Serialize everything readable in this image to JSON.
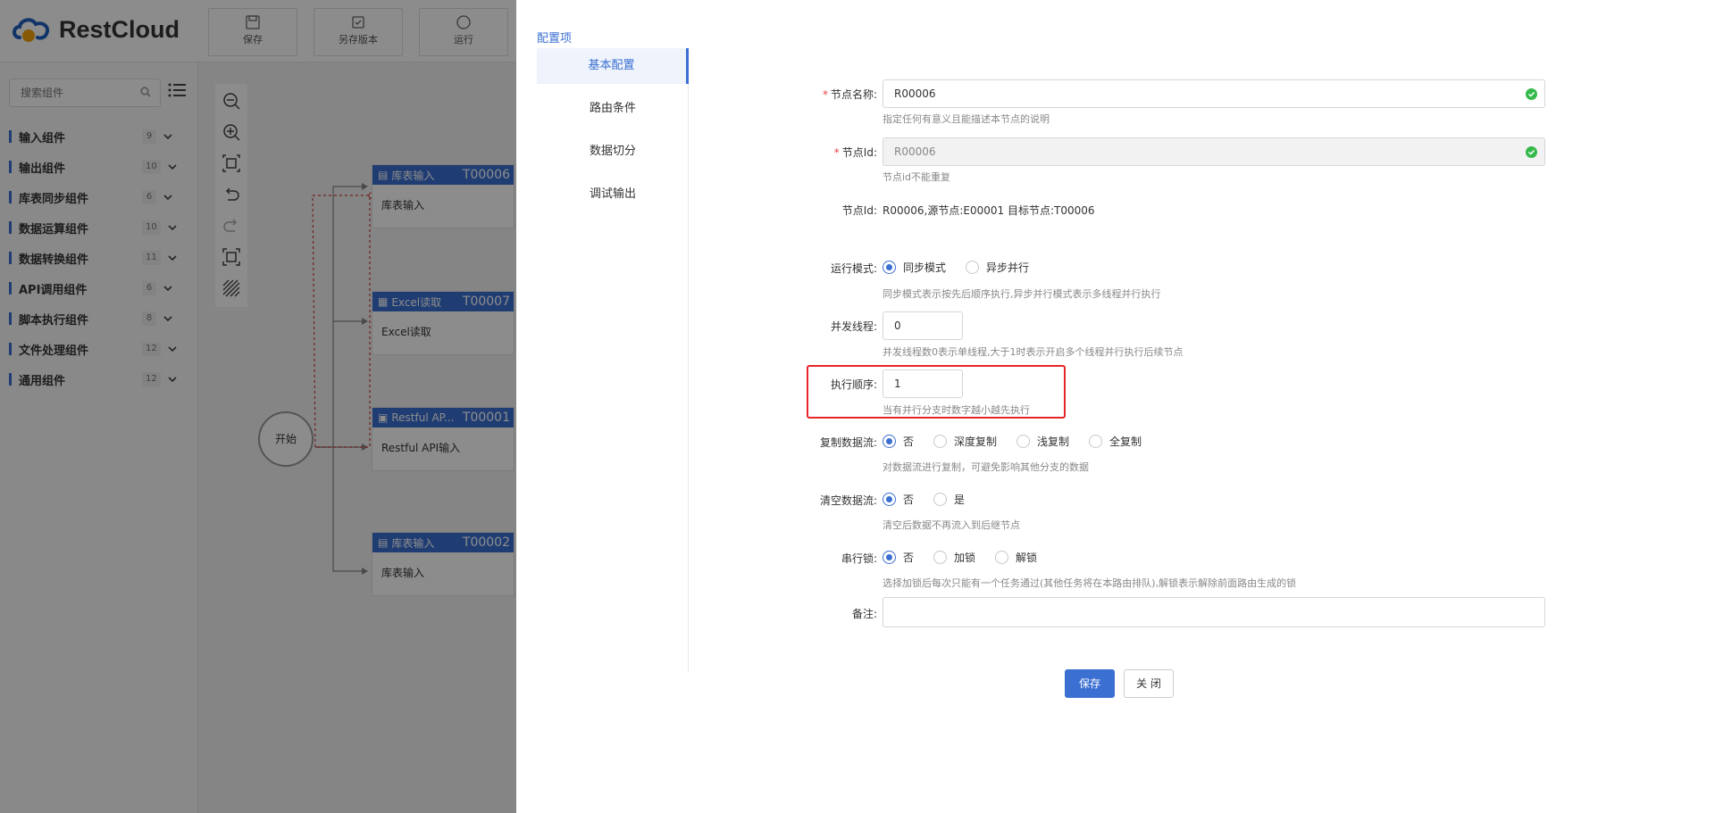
{
  "app": {
    "logo_text": "RestCloud",
    "toolbar": {
      "save_label": "保存",
      "save_as_label": "另存版本",
      "run_label": "运行"
    }
  },
  "sidebar": {
    "search_placeholder": "搜索组件",
    "categories": [
      {
        "label": "输入组件",
        "count": "9"
      },
      {
        "label": "输出组件",
        "count": "10"
      },
      {
        "label": "库表同步组件",
        "count": "6"
      },
      {
        "label": "数据运算组件",
        "count": "10"
      },
      {
        "label": "数据转换组件",
        "count": "11"
      },
      {
        "label": "API调用组件",
        "count": "6"
      },
      {
        "label": "脚本执行组件",
        "count": "8"
      },
      {
        "label": "文件处理组件",
        "count": "12"
      },
      {
        "label": "通用组件",
        "count": "12"
      }
    ]
  },
  "canvas": {
    "start_label": "开始",
    "nodes": [
      {
        "title": "库表输入",
        "id": "T00006",
        "body": "库表输入"
      },
      {
        "title": "Excel读取",
        "id": "T00007",
        "body": "Excel读取"
      },
      {
        "title": "Restful AP...",
        "id": "T00001",
        "body": "Restful API输入"
      },
      {
        "title": "库表输入",
        "id": "T00002",
        "body": "库表输入"
      }
    ]
  },
  "drawer": {
    "title": "配置项",
    "tabs": [
      "基本配置",
      "路由条件",
      "数据切分",
      "调试输出"
    ],
    "active_tab": "基本配置",
    "form": {
      "node_name": {
        "label": "节点名称:",
        "value": "R00006",
        "hint": "指定任何有意义且能描述本节点的说明"
      },
      "node_id": {
        "label": "节点Id:",
        "value": "R00006",
        "hint": "节点id不能重复"
      },
      "node_info": {
        "label": "节点Id:",
        "value": "R00006,源节点:E00001 目标节点:T00006"
      },
      "run_mode": {
        "label": "运行模式:",
        "options": [
          "同步模式",
          "异步并行"
        ],
        "selected": "同步模式",
        "hint": "同步模式表示按先后顺序执行,异步并行模式表示多线程并行执行"
      },
      "threads": {
        "label": "并发线程:",
        "value": "0",
        "hint": "并发线程数0表示单线程,大于1时表示开启多个线程并行执行后续节点"
      },
      "exec_order": {
        "label": "执行顺序:",
        "value": "1",
        "hint": "当有并行分支时数字越小越先执行"
      },
      "copy_stream": {
        "label": "复制数据流:",
        "options": [
          "否",
          "深度复制",
          "浅复制",
          "全复制"
        ],
        "selected": "否",
        "hint": "对数据流进行复制，可避免影响其他分支的数据"
      },
      "clear_stream": {
        "label": "清空数据流:",
        "options": [
          "否",
          "是"
        ],
        "selected": "否",
        "hint": "清空后数据不再流入到后继节点"
      },
      "serial_lock": {
        "label": "串行锁:",
        "options": [
          "否",
          "加锁",
          "解锁"
        ],
        "selected": "否",
        "hint": "选择加锁后每次只能有一个任务通过(其他任务将在本路由排队),解锁表示解除前面路由生成的锁"
      },
      "remark": {
        "label": "备注:",
        "value": ""
      }
    },
    "save_label": "保存",
    "close_label": "关 闭"
  },
  "colors": {
    "accent": "#3b6fd1",
    "required": "#e64242",
    "valid": "#35b94b",
    "highlight": "#e5252a"
  }
}
